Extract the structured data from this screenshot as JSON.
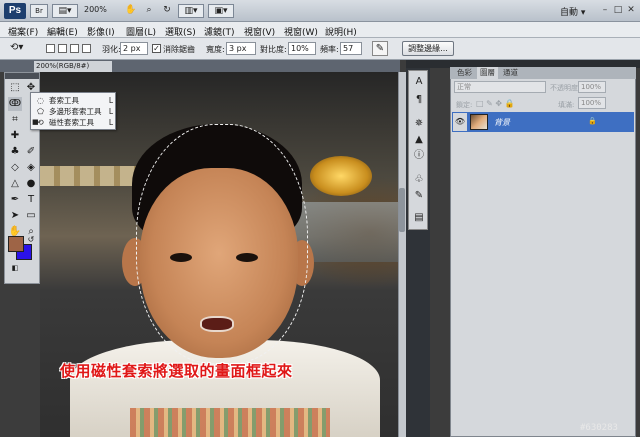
{
  "app": {
    "logo": "Ps",
    "bridge": "Br",
    "zoom": "200%",
    "workspace": "自動 ▾"
  },
  "window_controls": {
    "minimize": "–",
    "restore": "□",
    "close": "✕"
  },
  "menu": [
    "檔案(F)",
    "編輯(E)",
    "影像(I)",
    "圖層(L)",
    "選取(S)",
    "濾鏡(T)",
    "視窗(V)",
    "視窗(W)",
    "說明(H)"
  ],
  "options": {
    "feather_label": "羽化:",
    "feather_value": "2 px",
    "antialias_label": "消除鋸齒",
    "width_label": "寬度:",
    "width_value": "3 px",
    "contrast_label": "對比度:",
    "contrast_value": "10%",
    "frequency_label": "頻率:",
    "frequency_value": "57",
    "refine_edge": "調整邊緣..."
  },
  "document": {
    "tab_title": "200%(RGB/8#)"
  },
  "lasso_flyout": [
    {
      "icon": "lasso-icon",
      "label": "套索工具",
      "key": "L"
    },
    {
      "icon": "polygonal-lasso-icon",
      "label": "多邊形套索工具",
      "key": "L"
    },
    {
      "icon": "magnetic-lasso-icon",
      "label": "磁性套索工具",
      "key": "L"
    }
  ],
  "caption": "使用磁性套索將選取的畫面框起來",
  "panels": {
    "tabs": [
      "色彩",
      "圖層",
      "通道"
    ],
    "blend_mode": "正常",
    "opacity_label": "不透明度:",
    "opacity_value": "100%",
    "lock_label": "鎖定:",
    "fill_label": "填滿:",
    "fill_value": "100%",
    "layer_name": "背景"
  },
  "colors": {
    "foreground": "#9e6446",
    "background": "#2b12e8",
    "selected_layer": "#3e6fc2",
    "caption": "#e01818"
  },
  "watermark": "#630283"
}
